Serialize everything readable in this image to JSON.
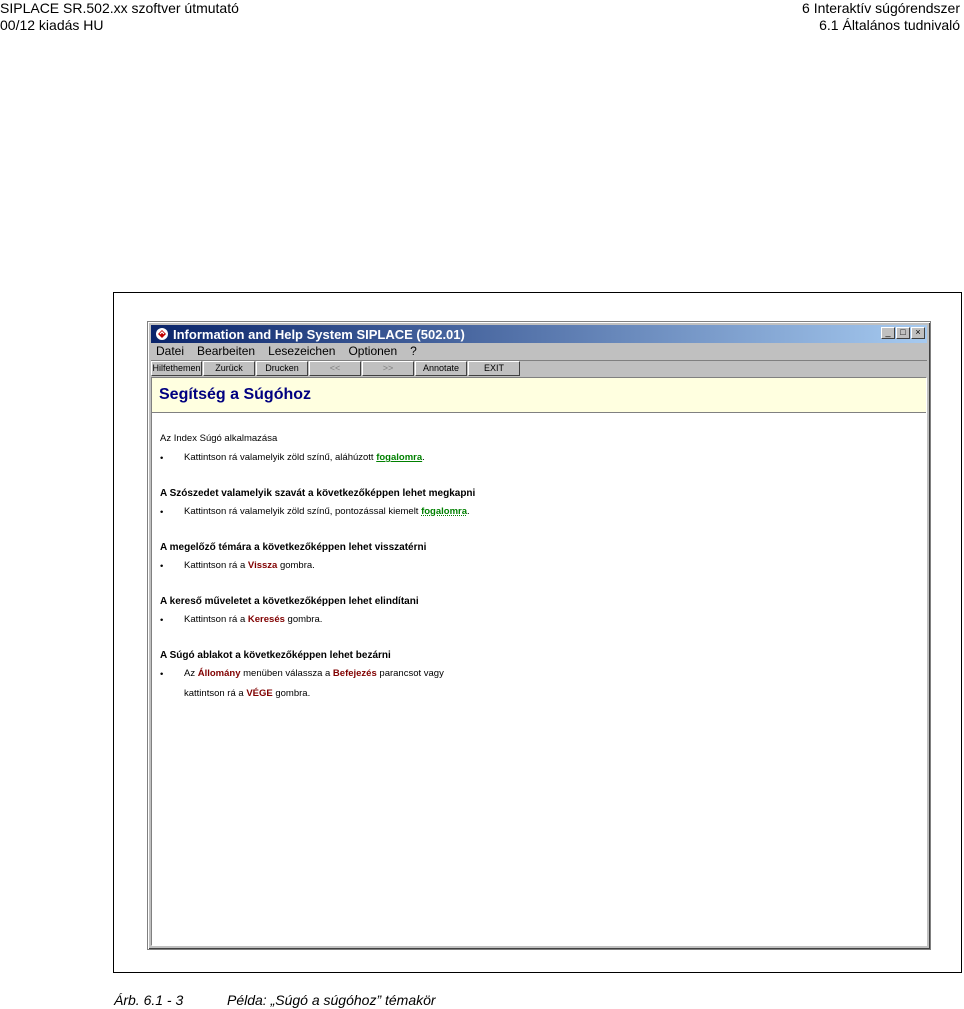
{
  "header": {
    "left_line1": "SIPLACE SR.502.xx szoftver útmutató",
    "left_line2": "00/12 kiadás HU",
    "right_line1": "6 Interaktív súgórendszer",
    "right_line2": "6.1 Általános tudnivaló"
  },
  "window": {
    "title": "Information and Help System SIPLACE (502.01)",
    "controls": [
      "_",
      "□",
      "×"
    ],
    "menu": [
      "Datei",
      "Bearbeiten",
      "Lesezeichen",
      "Optionen",
      "?"
    ],
    "toolbar": [
      "Hilfethemen",
      "Zurück",
      "Drucken",
      "<<",
      ">>",
      "Annotate",
      "EXIT"
    ]
  },
  "help": {
    "title": "Segítség a Súgóhoz",
    "intro": "Az Index Súgó alkalmazása",
    "s0_b_pre": "Kattintson rá valamelyik zöld színű, aláhúzott ",
    "s0_b_link": "fogalomra",
    "s0_b_post": ".",
    "s1_head": "A Szószedet valamelyik szavát a következőképpen lehet megkapni",
    "s1_b_pre": "Kattintson rá valamelyik zöld színű, pontozással kiemelt ",
    "s1_b_link": "fogalomra",
    "s1_b_post": ".",
    "s2_head": "A megelőző témára a következőképpen lehet visszatérni",
    "s2_b_pre": "Kattintson rá a ",
    "s2_b_key": "Vissza",
    "s2_b_post": " gombra.",
    "s3_head": "A kereső műveletet a következőképpen lehet elindítani",
    "s3_b_pre": "Kattintson rá a ",
    "s3_b_key": "Keresés",
    "s3_b_post": " gombra.",
    "s4_head": "A Súgó ablakot a következőképpen lehet bezárni",
    "s4_b_pre": "Az ",
    "s4_b_key1": "Állomány",
    "s4_b_mid": " menüben válassza a ",
    "s4_b_key2": "Befejezés",
    "s4_b_post": " parancsot vagy",
    "s4_b2_pre": "kattintson rá a ",
    "s4_b2_key": "VÉGE",
    "s4_b2_post": " gombra.",
    "bullet": "•"
  },
  "caption": {
    "label": "Árb. 6.1 - 3",
    "text": "Példa: „Súgó a súgóhoz” témakör"
  },
  "colors": {
    "title_bar": "#0a246a",
    "link_green": "#008000",
    "key_red": "#800000",
    "banner": "#ffffe0",
    "banner_text": "#000080"
  }
}
